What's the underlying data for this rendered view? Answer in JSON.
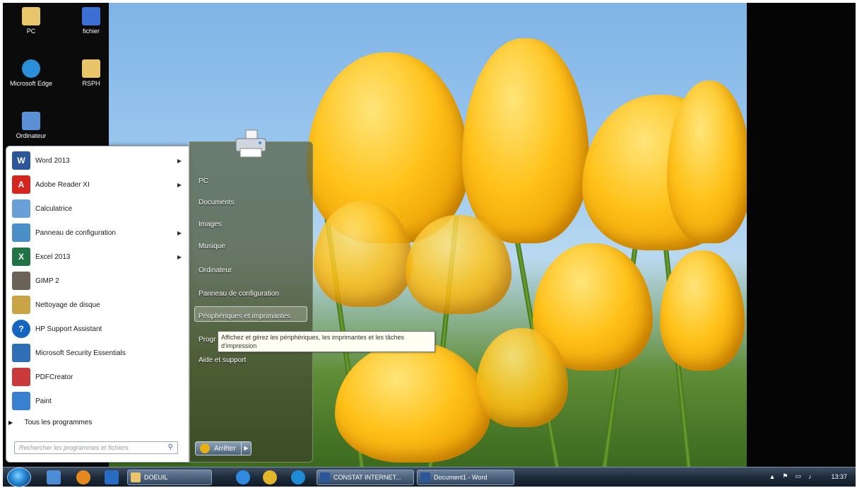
{
  "desktop": {
    "icons": [
      {
        "label": "PC",
        "icon": "folder-pc-icon",
        "color": "#e8c46a"
      },
      {
        "label": "fichier",
        "icon": "document-icon",
        "color": "#3b6fd4"
      },
      {
        "label": "Microsoft Edge",
        "icon": "edge-icon",
        "color": "#2a8fd8"
      },
      {
        "label": "RSPH",
        "icon": "folder-icon",
        "color": "#e8c46a"
      },
      {
        "label": "Ordinateur",
        "icon": "computer-icon",
        "color": "#5b8fd6"
      }
    ]
  },
  "start_menu": {
    "programs": [
      {
        "label": "Word 2013",
        "icon": "word-icon",
        "color": "#2b579a",
        "letter": "W",
        "has_submenu": true
      },
      {
        "label": "Adobe Reader XI",
        "icon": "adobe-reader-icon",
        "color": "#d4261f",
        "letter": "A",
        "has_submenu": true
      },
      {
        "label": "Calculatrice",
        "icon": "calculator-icon",
        "color": "#6aa0d8",
        "letter": "",
        "has_submenu": false
      },
      {
        "label": "Panneau de configuration",
        "icon": "control-panel-icon",
        "color": "#4a90c8",
        "letter": "",
        "has_submenu": true
      },
      {
        "label": "Excel 2013",
        "icon": "excel-icon",
        "color": "#217346",
        "letter": "X",
        "has_submenu": true
      },
      {
        "label": "GIMP 2",
        "icon": "gimp-icon",
        "color": "#6b6257",
        "letter": "",
        "has_submenu": false
      },
      {
        "label": "Nettoyage de disque",
        "icon": "disk-cleanup-icon",
        "color": "#c9a447",
        "letter": "",
        "has_submenu": false
      },
      {
        "label": "HP Support Assistant",
        "icon": "help-icon",
        "color": "#1565c0",
        "letter": "?",
        "has_submenu": false
      },
      {
        "label": "Microsoft Security Essentials",
        "icon": "shield-icon",
        "color": "#2f6fb5",
        "letter": "",
        "has_submenu": false
      },
      {
        "label": "PDFCreator",
        "icon": "pdf-creator-icon",
        "color": "#c93a3a",
        "letter": "",
        "has_submenu": false
      },
      {
        "label": "Paint",
        "icon": "paint-icon",
        "color": "#3a80d0",
        "letter": "",
        "has_submenu": false
      }
    ],
    "all_programs": "Tous les programmes",
    "search_placeholder": "Rechercher les programmes et fichiers",
    "right_links": [
      "PC",
      "Documents",
      "Images",
      "Musique",
      "Ordinateur",
      "Panneau de configuration",
      "Périphériques et imprimantes",
      "Programmes par défaut",
      "Aide et support"
    ],
    "right_links_visible": [
      "PC",
      "Documents",
      "Images",
      "Musique",
      "Ordinateur",
      "Panneau de configuration",
      "Périphériques et imprimantes",
      "Progr",
      "Aide et support"
    ],
    "highlighted_link": "Périphériques et imprimantes",
    "shutdown_label": "Arrêter",
    "tooltip": "Affichez et gérez les périphériques, les imprimantes et les tâches d'impression"
  },
  "taskbar": {
    "pinned": [
      {
        "icon": "windows-explorer-icon",
        "color": "#4c8bd6"
      },
      {
        "icon": "firefox-icon",
        "color": "#e58a1f"
      },
      {
        "icon": "outlook-icon",
        "color": "#2a6cc4"
      }
    ],
    "open_windows": [
      {
        "label": "DOEUIL",
        "icon": "folder-icon",
        "color": "#e8c46a"
      },
      {
        "label": "CONSTAT INTERNET...",
        "icon": "word-icon",
        "color": "#2b579a"
      },
      {
        "label": "Document1 - Word",
        "icon": "word-icon",
        "color": "#2b579a"
      }
    ],
    "browser_pins": [
      {
        "icon": "internet-explorer-icon",
        "color": "#2f8ae0"
      },
      {
        "icon": "chrome-icon",
        "color": "#e2b52a"
      },
      {
        "icon": "edge-icon",
        "color": "#1f8bd6"
      }
    ],
    "clock": "13:37"
  }
}
